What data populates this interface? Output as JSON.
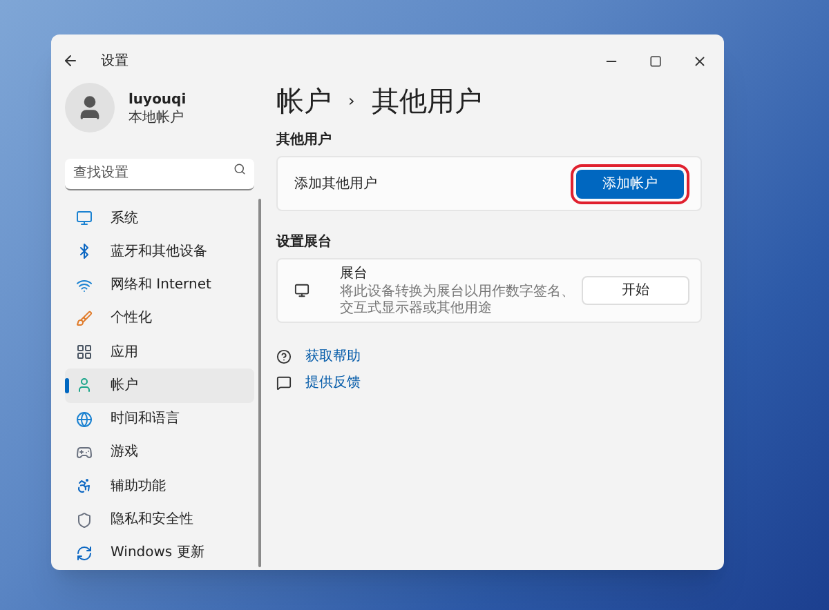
{
  "window": {
    "title": "设置"
  },
  "profile": {
    "name": "luyouqi",
    "account_type": "本地帐户"
  },
  "search": {
    "placeholder": "查找设置"
  },
  "sidebar": {
    "items": [
      {
        "kind": "system",
        "label": "系统",
        "selected": false
      },
      {
        "kind": "bluetooth",
        "label": "蓝牙和其他设备",
        "selected": false
      },
      {
        "kind": "network",
        "label": "网络和 Internet",
        "selected": false
      },
      {
        "kind": "personalization",
        "label": "个性化",
        "selected": false
      },
      {
        "kind": "apps",
        "label": "应用",
        "selected": false
      },
      {
        "kind": "accounts",
        "label": "帐户",
        "selected": true
      },
      {
        "kind": "time",
        "label": "时间和语言",
        "selected": false
      },
      {
        "kind": "gaming",
        "label": "游戏",
        "selected": false
      },
      {
        "kind": "accessibility",
        "label": "辅助功能",
        "selected": false
      },
      {
        "kind": "privacy",
        "label": "隐私和安全性",
        "selected": false
      },
      {
        "kind": "update",
        "label": "Windows 更新",
        "selected": false
      }
    ]
  },
  "breadcrumb": {
    "parent": "帐户",
    "separator": "›",
    "current": "其他用户"
  },
  "sections": [
    {
      "heading": "其他用户",
      "cards": [
        {
          "kind": "action",
          "title": "添加其他用户",
          "button": {
            "label": "添加帐户",
            "primary": true,
            "highlighted": true
          }
        }
      ]
    },
    {
      "heading": "设置展台",
      "cards": [
        {
          "kind": "kiosk",
          "title": "展台",
          "description": "将此设备转换为展台以用作数字签名、交互式显示器或其他用途",
          "button": {
            "label": "开始",
            "primary": false,
            "highlighted": false
          }
        }
      ]
    }
  ],
  "links": [
    {
      "kind": "help",
      "label": "获取帮助"
    },
    {
      "kind": "feedback",
      "label": "提供反馈"
    }
  ]
}
